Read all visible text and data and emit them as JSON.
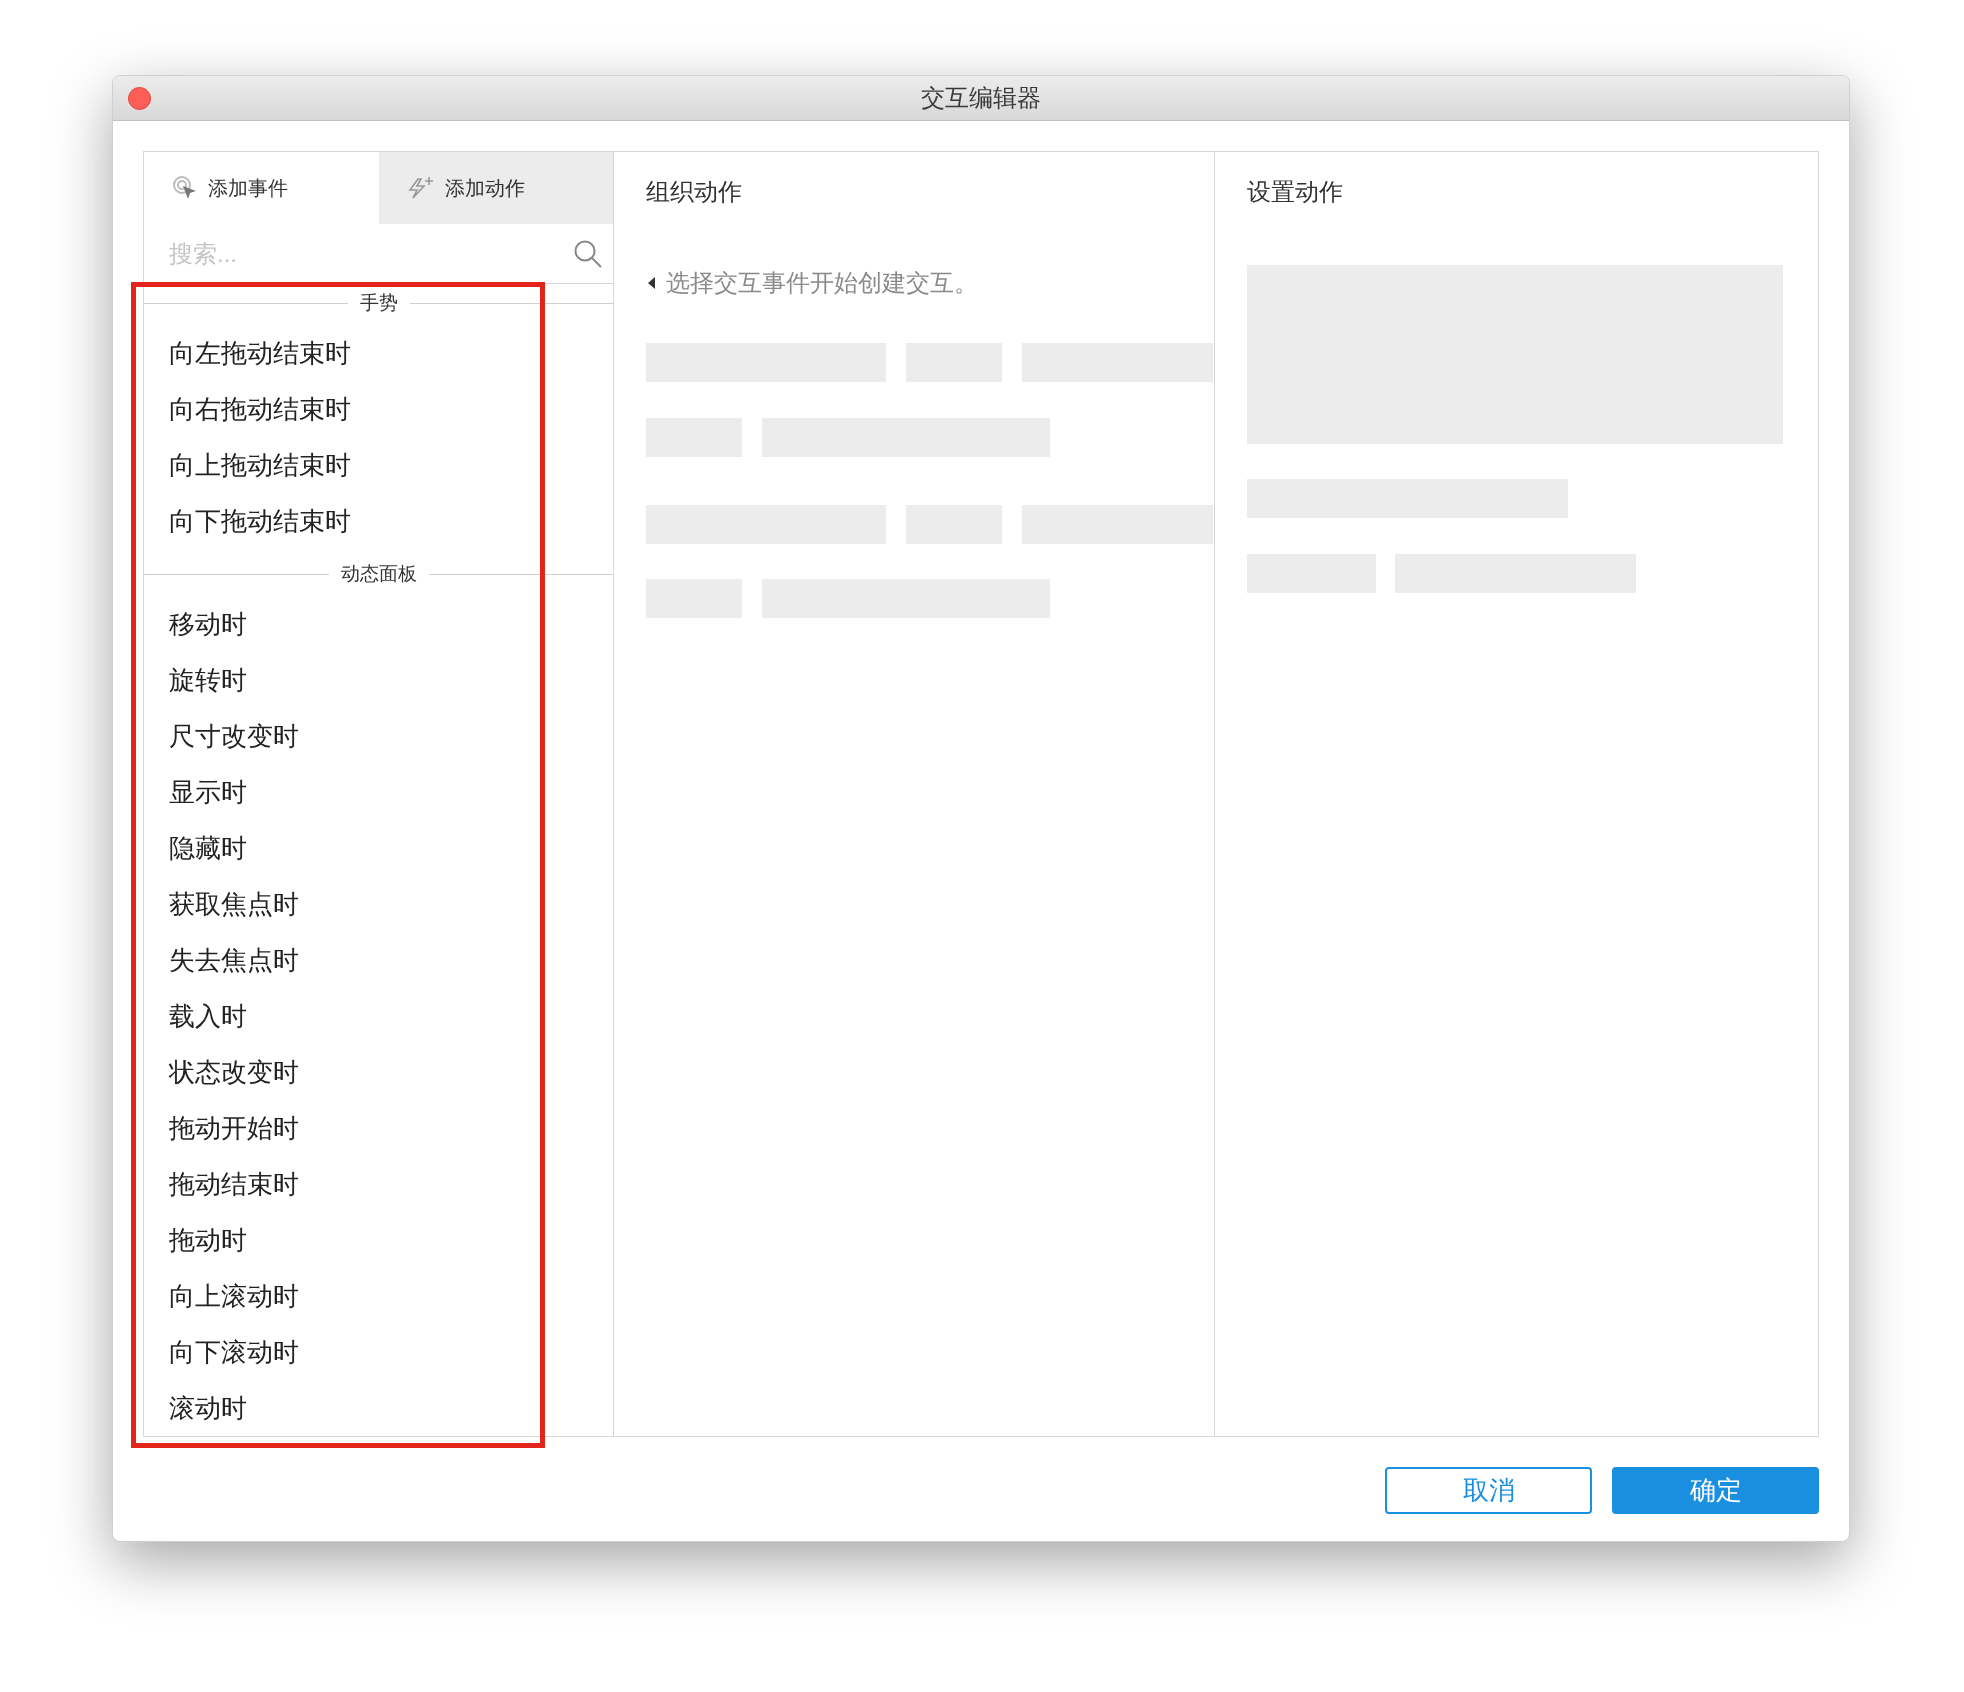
{
  "window": {
    "title": "交互编辑器"
  },
  "tabs": [
    {
      "label": "添加事件",
      "selected": true
    },
    {
      "label": "添加动作",
      "selected": false
    }
  ],
  "search": {
    "placeholder": "搜索..."
  },
  "event_groups": [
    {
      "title": "手势",
      "items": [
        "向左拖动结束时",
        "向右拖动结束时",
        "向上拖动结束时",
        "向下拖动结束时"
      ]
    },
    {
      "title": "动态面板",
      "items": [
        "移动时",
        "旋转时",
        "尺寸改变时",
        "显示时",
        "隐藏时",
        "获取焦点时",
        "失去焦点时",
        "载入时",
        "状态改变时",
        "拖动开始时",
        "拖动结束时",
        "拖动时",
        "向上滚动时",
        "向下滚动时",
        "滚动时"
      ]
    }
  ],
  "organize_panel": {
    "title": "组织动作",
    "hint": "选择交互事件开始创建交互。"
  },
  "settings_panel": {
    "title": "设置动作"
  },
  "buttons": [
    {
      "label": "取消",
      "kind": "secondary"
    },
    {
      "label": "确定",
      "kind": "primary"
    }
  ]
}
